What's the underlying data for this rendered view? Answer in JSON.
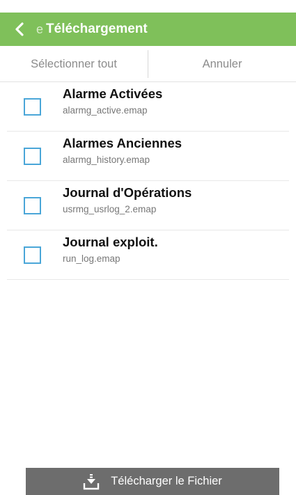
{
  "header": {
    "back_icon": "chevron-left-icon",
    "title_prefix": "e",
    "title": "Téléchargement",
    "background_color": "#7fc05a"
  },
  "actions": {
    "select_all_label": "Sélectionner tout",
    "cancel_label": "Annuler"
  },
  "files": [
    {
      "name": "Alarme Activées",
      "path": "alarmg_active.emap",
      "checked": false
    },
    {
      "name": "Alarmes Anciennes",
      "path": "alarmg_history.emap",
      "checked": false
    },
    {
      "name": "Journal d'Opérations",
      "path": "usrmg_usrlog_2.emap",
      "checked": false
    },
    {
      "name": "Journal exploit.",
      "path": "run_log.emap",
      "checked": false
    }
  ],
  "download": {
    "label": "Télécharger le Fichier",
    "icon": "download-icon"
  },
  "colors": {
    "checkbox_border": "#4aa6d8",
    "download_button": "#6d6d6d"
  }
}
